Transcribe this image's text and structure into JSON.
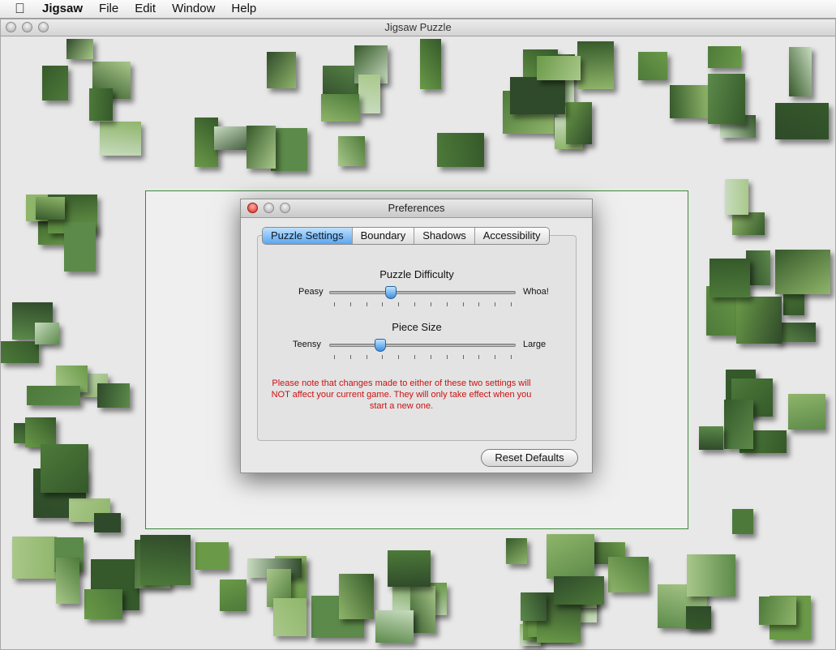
{
  "menubar": {
    "apple_icon": "apple-icon",
    "app_name": "Jigsaw",
    "items": [
      "File",
      "Edit",
      "Window",
      "Help"
    ]
  },
  "window": {
    "title": "Jigsaw Puzzle"
  },
  "preferences": {
    "title": "Preferences",
    "tabs": [
      {
        "label": "Puzzle Settings",
        "selected": true
      },
      {
        "label": "Boundary",
        "selected": false
      },
      {
        "label": "Shadows",
        "selected": false
      },
      {
        "label": "Accessibility",
        "selected": false
      }
    ],
    "difficulty": {
      "label": "Puzzle Difficulty",
      "min_label": "Peasy",
      "max_label": "Whoa!",
      "value_fraction": 0.33,
      "tick_count": 12
    },
    "piece_size": {
      "label": "Piece Size",
      "min_label": "Teensy",
      "max_label": "Large",
      "value_fraction": 0.27,
      "tick_count": 12
    },
    "note": "Please note that changes made to either of these two settings will NOT affect your current game. They will only take effect when you start a new one.",
    "reset_button": "Reset Defaults"
  },
  "colors": {
    "piece_greens": [
      "#4d7a3a",
      "#6a9a48",
      "#8fb56a",
      "#35592a",
      "#a9c88a",
      "#5c8a4a",
      "#2f4a2a",
      "#c8dcc0"
    ],
    "target_border": "#3a8a3a",
    "note_red": "#cc1111",
    "tab_selected": "#5aa6ee"
  }
}
